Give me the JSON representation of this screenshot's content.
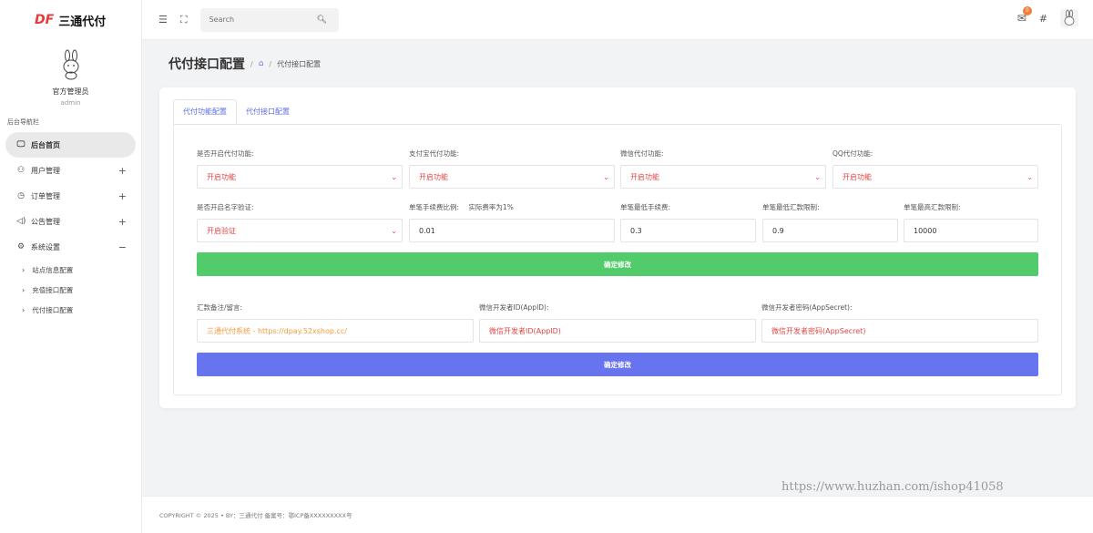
{
  "brand": {
    "logo": "DF",
    "name": "三通代付"
  },
  "profile": {
    "name": "官方管理员",
    "role": "admin"
  },
  "nav": {
    "caption": "后台导航栏",
    "items": [
      {
        "label": "后台首页",
        "icon": "monitor-icon",
        "active": true
      },
      {
        "label": "用户管理",
        "icon": "user-icon",
        "toggle": "+"
      },
      {
        "label": "订单管理",
        "icon": "clock-icon",
        "toggle": "+"
      },
      {
        "label": "公告管理",
        "icon": "speaker-icon",
        "toggle": "+"
      },
      {
        "label": "系统设置",
        "icon": "gear-icon",
        "toggle": "−"
      }
    ],
    "sub_items": [
      "站点信息配置",
      "充值接口配置",
      "代付接口配置"
    ]
  },
  "topbar": {
    "search_placeholder": "Search",
    "mail_badge": "0"
  },
  "page": {
    "title": "代付接口配置",
    "breadcrumb_current": "代付接口配置"
  },
  "tabs": [
    "代付功能配置",
    "代付接口配置"
  ],
  "form1": {
    "row1": [
      {
        "label": "是否开启代付功能:",
        "value": "开启功能"
      },
      {
        "label": "支付宝代付功能:",
        "value": "开启功能"
      },
      {
        "label": "微信代付功能:",
        "value": "开启功能"
      },
      {
        "label": "QQ代付功能:",
        "value": "开启功能"
      }
    ],
    "row2_select": {
      "label": "是否开启名字验证:",
      "value": "开启验证"
    },
    "row2_inputs": [
      {
        "label": "单笔手续费比例:",
        "hint": "实际费率为1%",
        "value": "0.01"
      },
      {
        "label": "单笔最低手续费:",
        "value": "0.3"
      },
      {
        "label": "单笔最低汇款限制:",
        "value": "0.9"
      },
      {
        "label": "单笔最高汇款限制:",
        "value": "10000"
      }
    ],
    "submit": "确定修改"
  },
  "form2": {
    "fields": [
      {
        "label": "汇款备注/留言:",
        "value": "三通代付系统 - https://dpay.52xshop.cc/"
      },
      {
        "label": "微信开发者ID(AppID):",
        "value": "微信开发者ID(AppID)"
      },
      {
        "label": "微信开发者密码(AppSecret):",
        "value": "微信开发者密码(AppSecret)"
      }
    ],
    "submit": "确定修改"
  },
  "footer": "COPYRIGHT © 2025 • BY：三通代付    备案号：鄂ICP备XXXXXXXXX号",
  "watermark": "https://www.huzhan.com/ishop41058",
  "colors": {
    "accent": "#6873ef",
    "green": "#52cc6a",
    "red": "#e04848",
    "orange": "#f59a3b"
  }
}
